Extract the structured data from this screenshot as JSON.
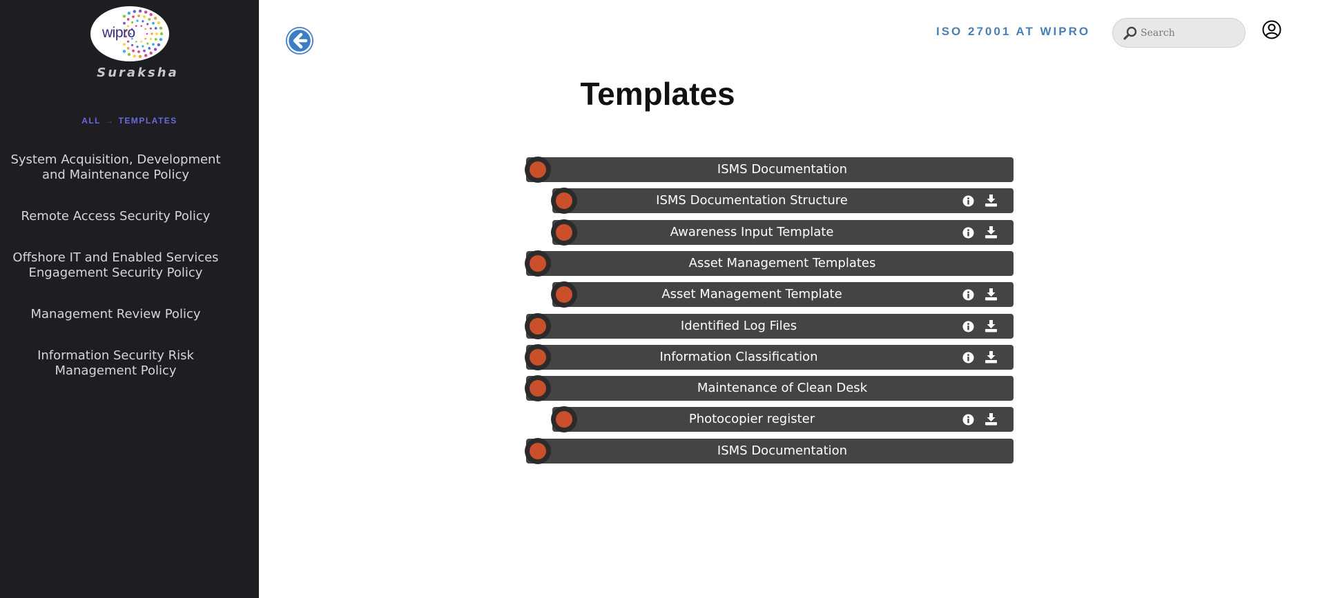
{
  "sidebar": {
    "logo_text": "wipro",
    "brand": "Suraksha",
    "breadcrumb": {
      "root": "ALL",
      "separator": "→",
      "current": "TEMPLATES"
    },
    "items": [
      {
        "label": "System Acquisition, Development and Maintenance Policy"
      },
      {
        "label": "Remote Access Security Policy"
      },
      {
        "label": "Offshore IT and Enabled Services Engagement Security Policy"
      },
      {
        "label": "Management Review Policy"
      },
      {
        "label": "Information Security Risk Management Policy"
      }
    ]
  },
  "header": {
    "title": "ISO 27001 AT WIPRO",
    "search_placeholder": "Search"
  },
  "main": {
    "title": "Templates",
    "rows": [
      {
        "label": "ISMS Documentation",
        "level": 0,
        "actions": false
      },
      {
        "label": "ISMS Documentation Structure",
        "level": 1,
        "actions": true
      },
      {
        "label": "Awareness Input Template",
        "level": 1,
        "actions": true
      },
      {
        "label": "Asset Management Templates",
        "level": 0,
        "actions": false
      },
      {
        "label": "Asset Management Template",
        "level": 1,
        "actions": true
      },
      {
        "label": "Identified Log Files",
        "level": 0,
        "actions": true
      },
      {
        "label": "Information Classification",
        "level": 0,
        "actions": true
      },
      {
        "label": "Maintenance of Clean Desk",
        "level": 0,
        "actions": false
      },
      {
        "label": "Photocopier register",
        "level": 1,
        "actions": true
      },
      {
        "label": "ISMS Documentation",
        "level": 0,
        "actions": false
      }
    ]
  },
  "colors": {
    "sidebar_bg": "#1e1e22",
    "row_bg": "#444444",
    "bullet": "#c9502a",
    "accent_blue": "#3d7dc6",
    "breadcrumb": "#6a6ae0"
  },
  "icons": {
    "back": "arrow-left-circle-icon",
    "search": "magnifier-icon",
    "user": "user-circle-icon",
    "info": "info-circle-icon",
    "download": "download-icon"
  }
}
